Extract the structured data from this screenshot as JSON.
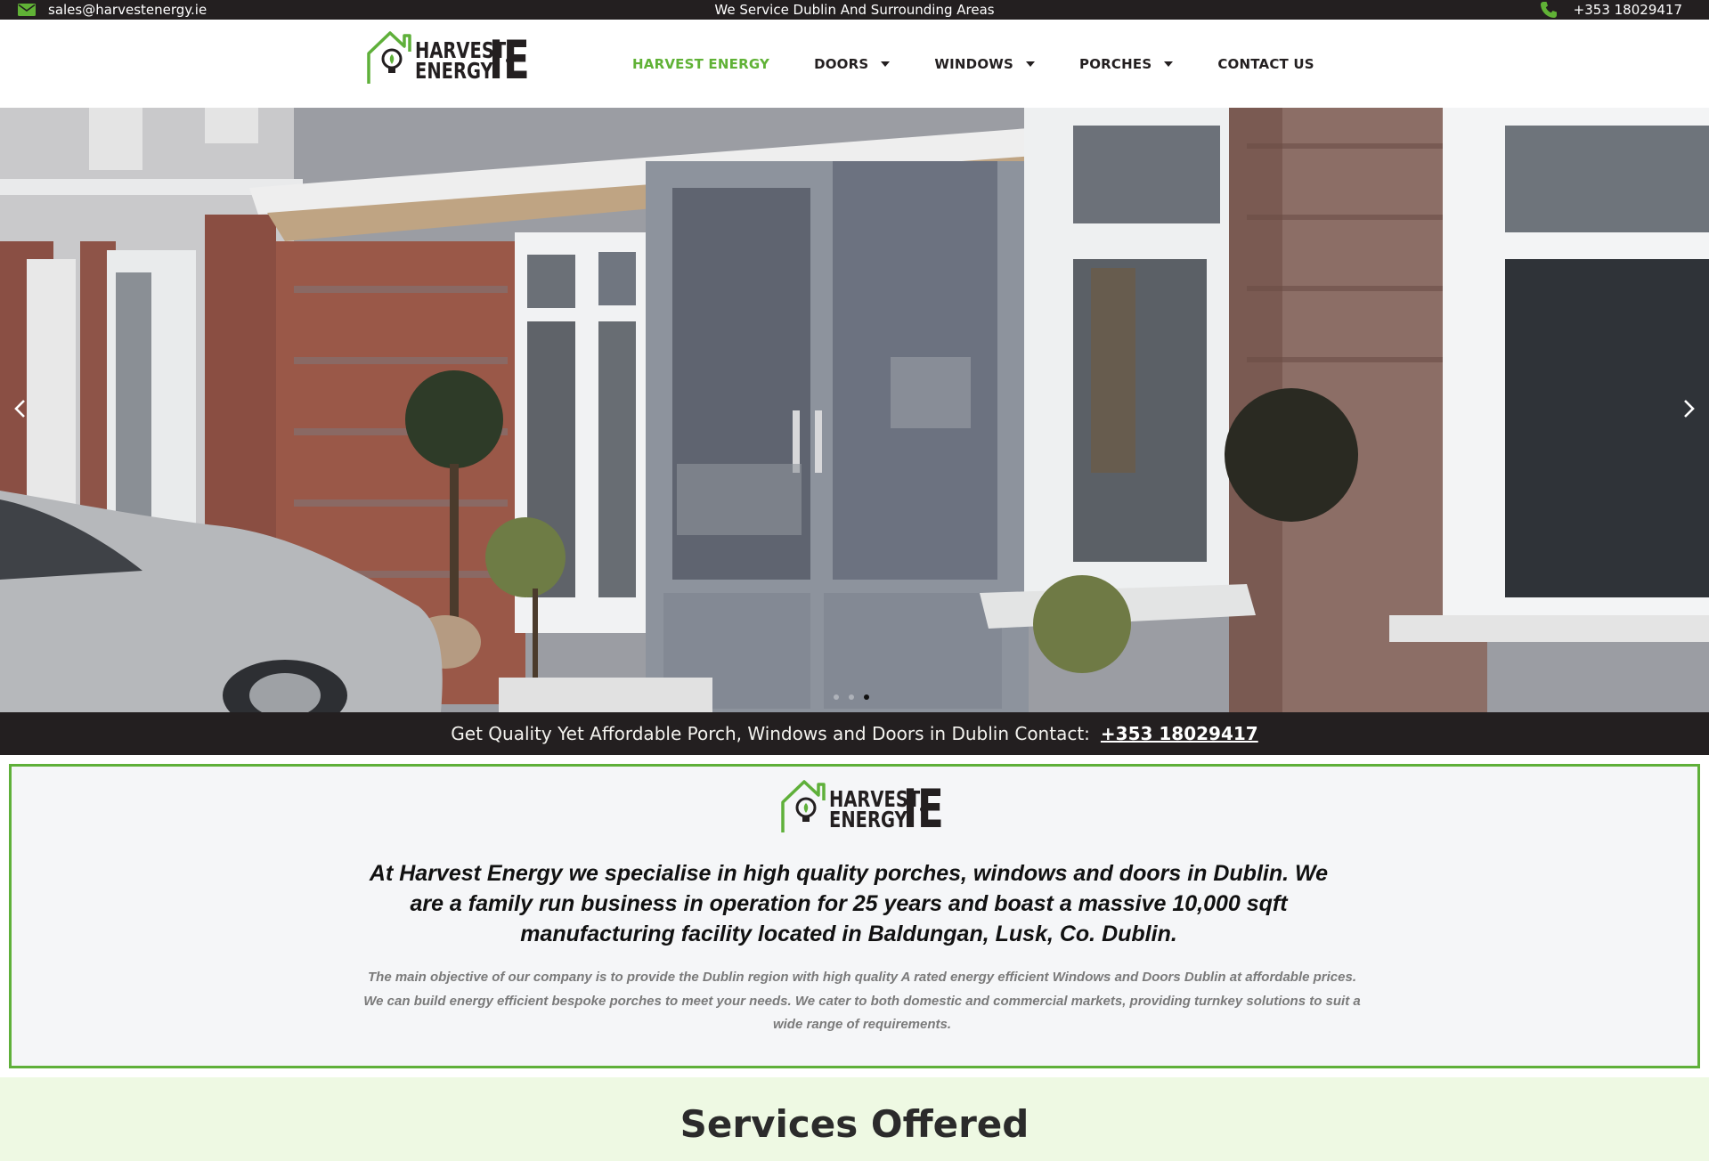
{
  "topbar": {
    "email": "sales@harvestenergy.ie",
    "service_area": "We Service Dublin And Surrounding Areas",
    "phone": "+353 18029417"
  },
  "brand": {
    "line1": "HARVEST",
    "line2": "ENERGY",
    "suffix": "IE"
  },
  "nav": {
    "items": [
      {
        "label": "HARVEST ENERGY",
        "active": true,
        "dropdown": false
      },
      {
        "label": "DOORS",
        "active": false,
        "dropdown": true
      },
      {
        "label": "WINDOWS",
        "active": false,
        "dropdown": true
      },
      {
        "label": "PORCHES",
        "active": false,
        "dropdown": true
      },
      {
        "label": "CONTACT US",
        "active": false,
        "dropdown": false
      }
    ]
  },
  "hero": {
    "slides_count": 3,
    "active_slide": 3
  },
  "strip": {
    "text": "Get Quality Yet Affordable Porch, Windows and Doors in Dublin Contact:",
    "phone": "+353 18029417"
  },
  "about": {
    "headline": "At Harvest Energy we specialise in high quality porches, windows and doors in Dublin. We are a family run business in operation for 25 years and boast a massive 10,000 sqft manufacturing facility located in Baldungan, Lusk, Co. Dublin.",
    "body": "The main objective of our company is to provide the Dublin region with high quality A rated energy efficient Windows and Doors Dublin at affordable prices. We can build energy efficient bespoke porches to meet your needs. We cater to both domestic and commercial markets, providing turnkey solutions to suit a wide range of requirements."
  },
  "services": {
    "title": "Services Offered"
  },
  "colors": {
    "accent_green": "#60b236",
    "dark": "#231f20"
  }
}
